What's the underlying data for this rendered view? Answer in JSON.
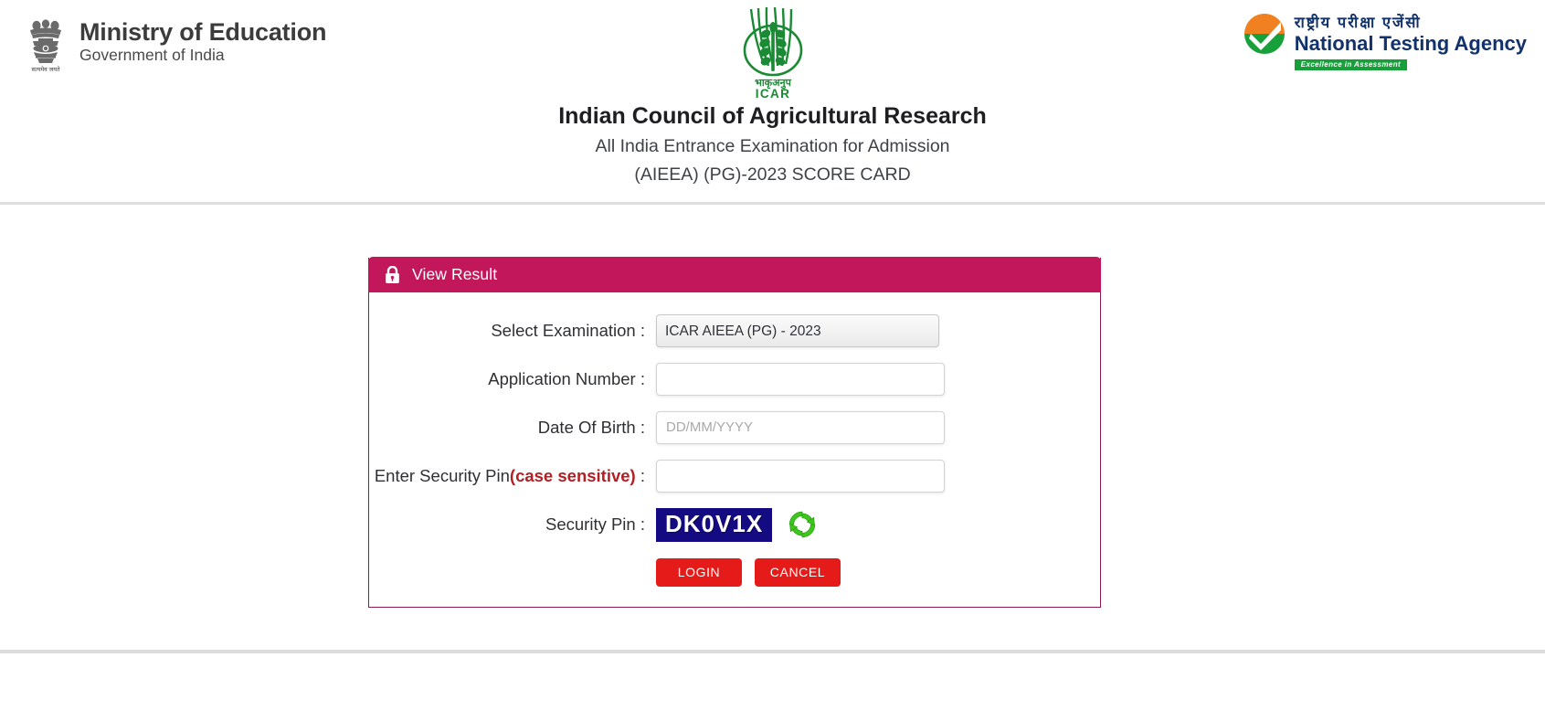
{
  "header": {
    "ministry": {
      "emblem_icon": "ashoka-emblem-icon",
      "title": "Ministry of Education",
      "subtitle": "Government of India",
      "emblem_motto": "सत्यमेव जयते"
    },
    "icar": {
      "logo_icon": "icar-wheat-logo-icon",
      "logo_hindi": "भाकृअनुप",
      "logo_acronym": "ICAR",
      "title": "Indian Council of Agricultural Research",
      "line2": "All India Entrance Examination for Admission",
      "line3": "(AIEEA) (PG)-2023 SCORE CARD"
    },
    "nta": {
      "mark_icon": "nta-checkmark-circle-icon",
      "hindi": "राष्ट्रीय परीक्षा एजेंसी",
      "english": "National Testing Agency",
      "tagline": "Excellence in Assessment"
    }
  },
  "panel": {
    "lock_icon": "lock-icon",
    "title": "View Result",
    "fields": {
      "exam": {
        "label": "Select Examination :",
        "selected": "ICAR AIEEA (PG) - 2023",
        "options": [
          "ICAR AIEEA (PG) - 2023"
        ]
      },
      "application_number": {
        "label": "Application Number :",
        "value": "",
        "placeholder": ""
      },
      "dob": {
        "label": "Date Of Birth :",
        "value": "",
        "placeholder": "DD/MM/YYYY"
      },
      "security_pin_input": {
        "label_main": "Enter Security Pin",
        "label_note": "(case sensitive)",
        "label_colon": " :",
        "value": "",
        "placeholder": ""
      },
      "security_pin_display": {
        "label": "Security Pin :",
        "captcha_text": "DK0V1X",
        "refresh_icon": "refresh-captcha-icon"
      }
    },
    "buttons": {
      "login": "LOGIN",
      "cancel": "CANCEL"
    }
  },
  "colors": {
    "panel_header": "#c2185b",
    "panel_border": "#8c1b52",
    "button_red": "#e51b19",
    "captcha_bg": "#140a82",
    "case_sensitive_red": "#b41f24",
    "nta_navy": "#12326b",
    "icar_green": "#1a8a34",
    "divider_gray": "#dedede"
  }
}
